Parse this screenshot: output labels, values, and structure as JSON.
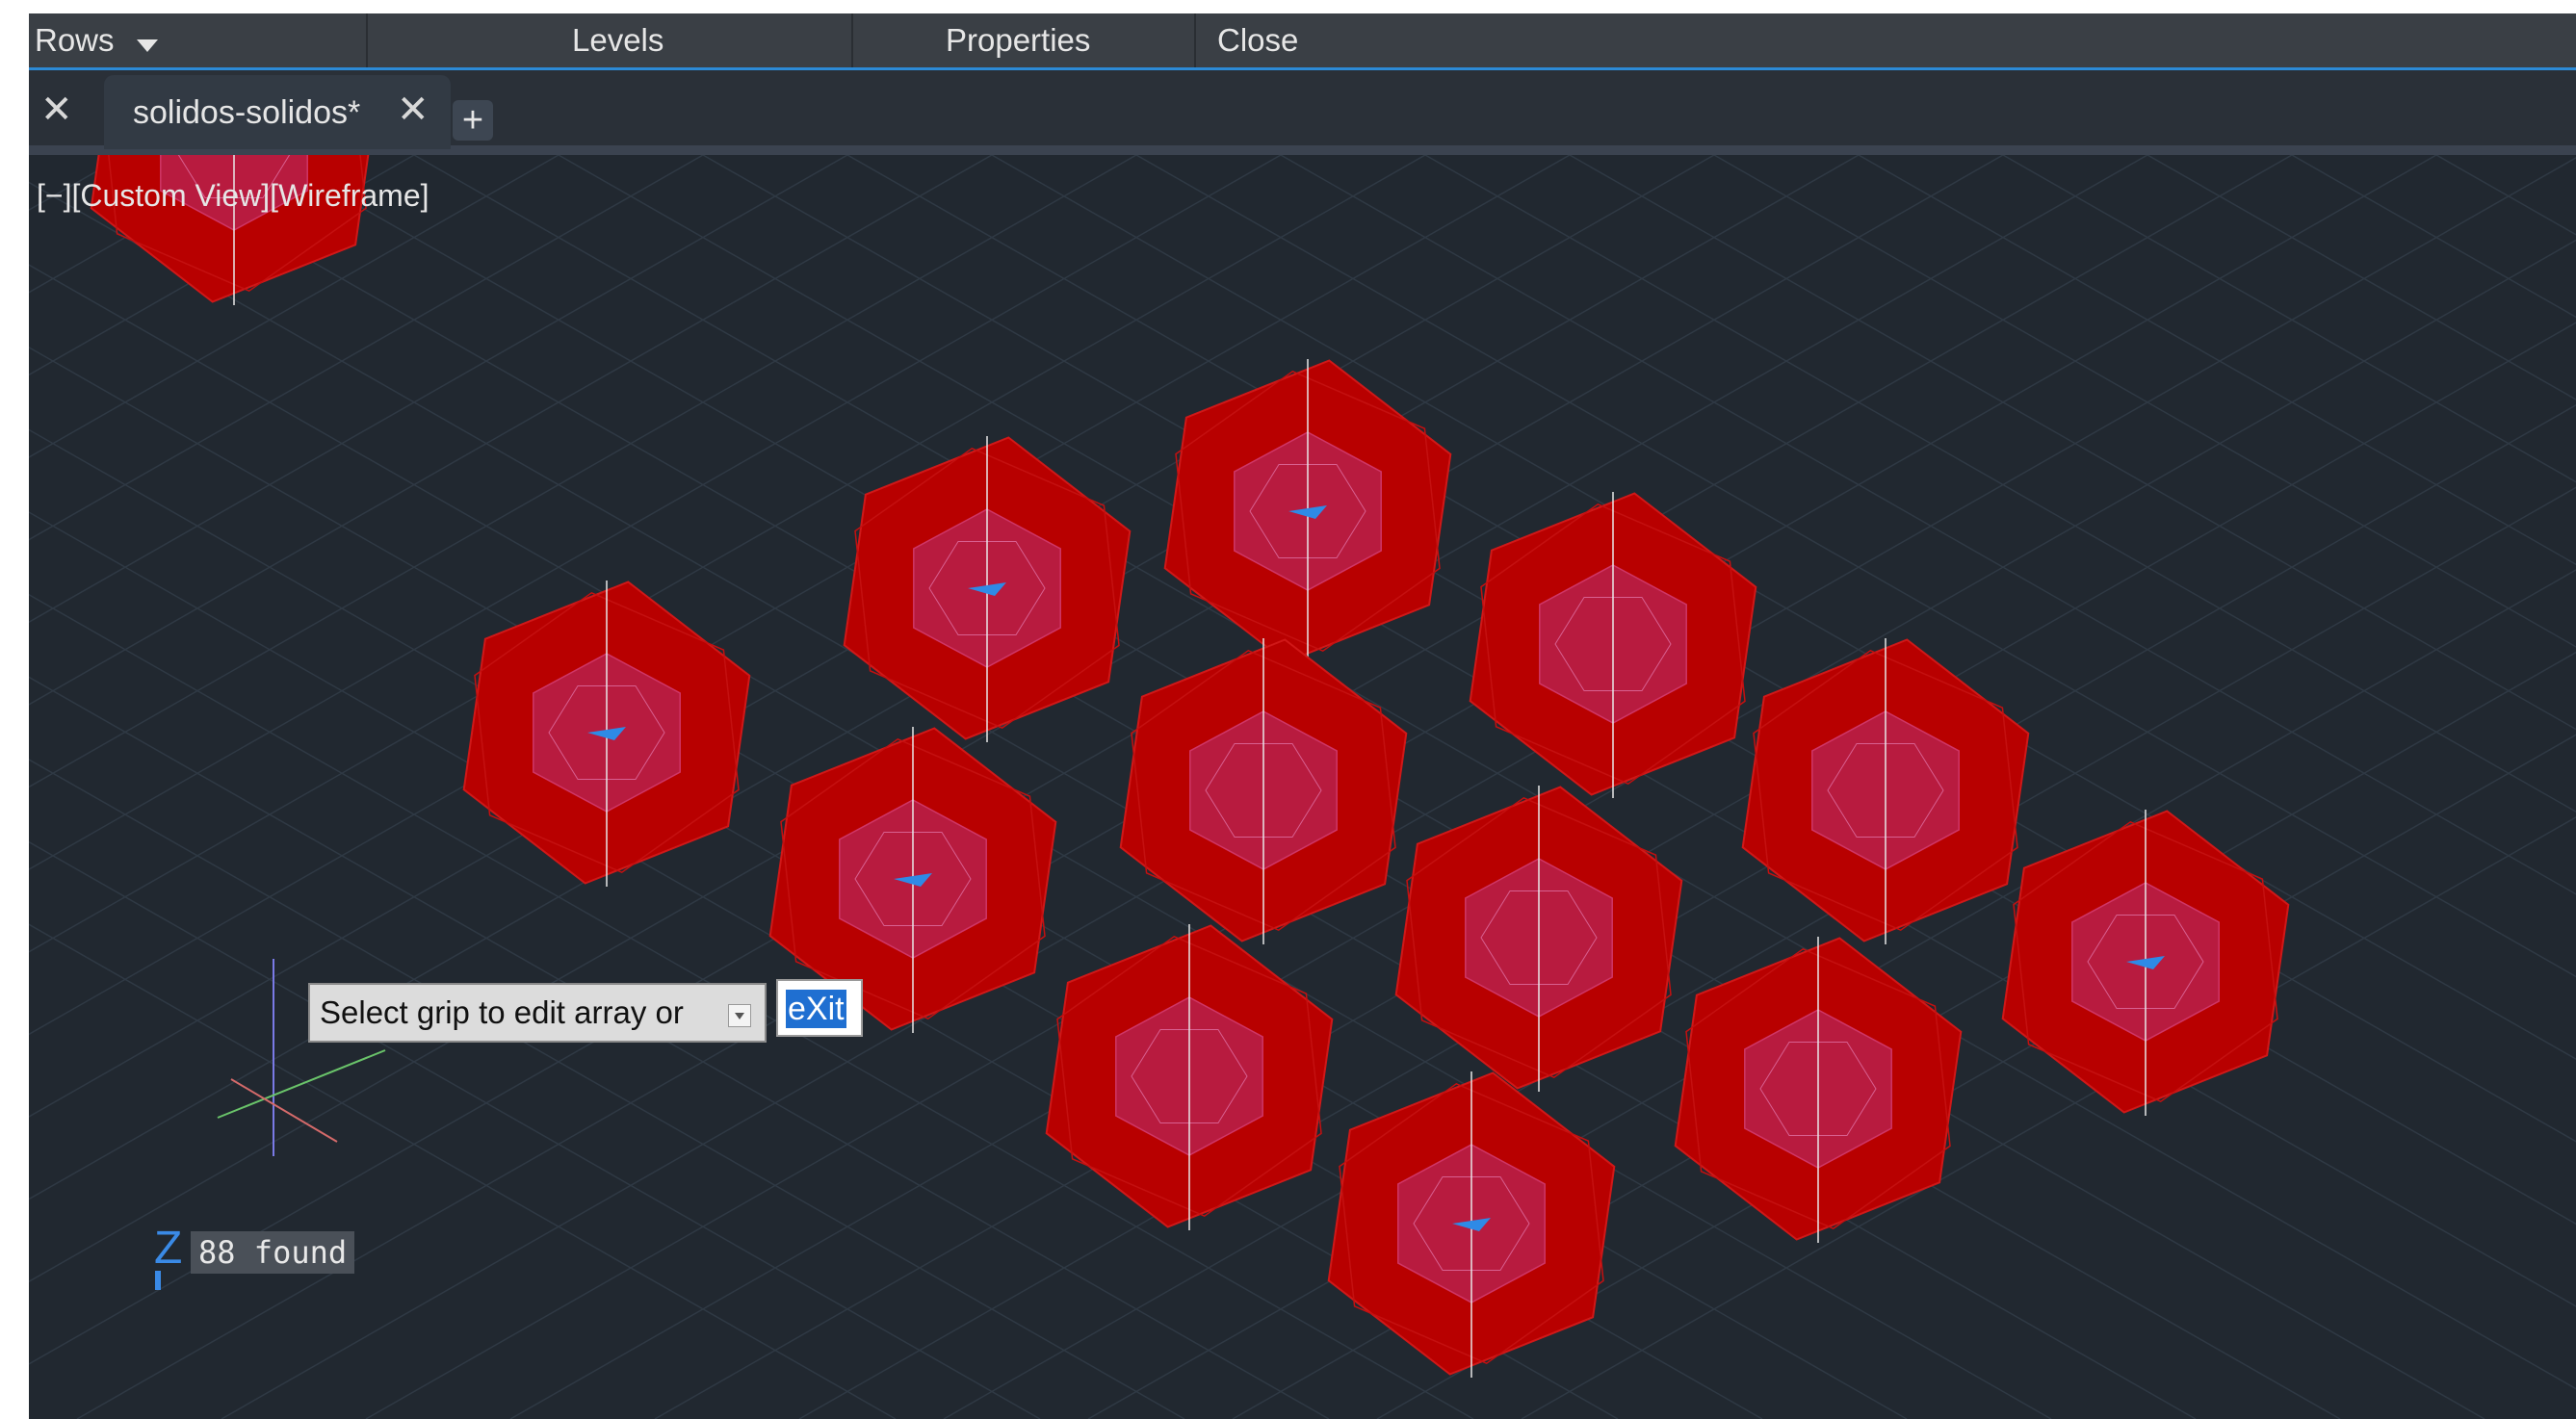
{
  "ribbon": {
    "rows_label": "Rows",
    "levels_label": "Levels",
    "properties_label": "Properties",
    "close_label": "Close"
  },
  "tabs": {
    "document_tab": "solidos-solidos*",
    "close_glyph": "✕",
    "new_tab_glyph": "+"
  },
  "viewport": {
    "view_label": "[−][Custom View][Wireframe]"
  },
  "prompt": {
    "text": "Select grip to edit array or",
    "input_value": "eXit"
  },
  "command_line": {
    "status": "88 found",
    "ucs_z_label": "Z"
  },
  "colors": {
    "solid_fill": "#b80000",
    "grip_blue": "#2e8ae6",
    "accent": "#2c8ad6"
  },
  "icons": [
    "close-icon",
    "chevron-down-icon",
    "plus-icon",
    "ucs-icon",
    "dropdown-arrow-icon"
  ]
}
